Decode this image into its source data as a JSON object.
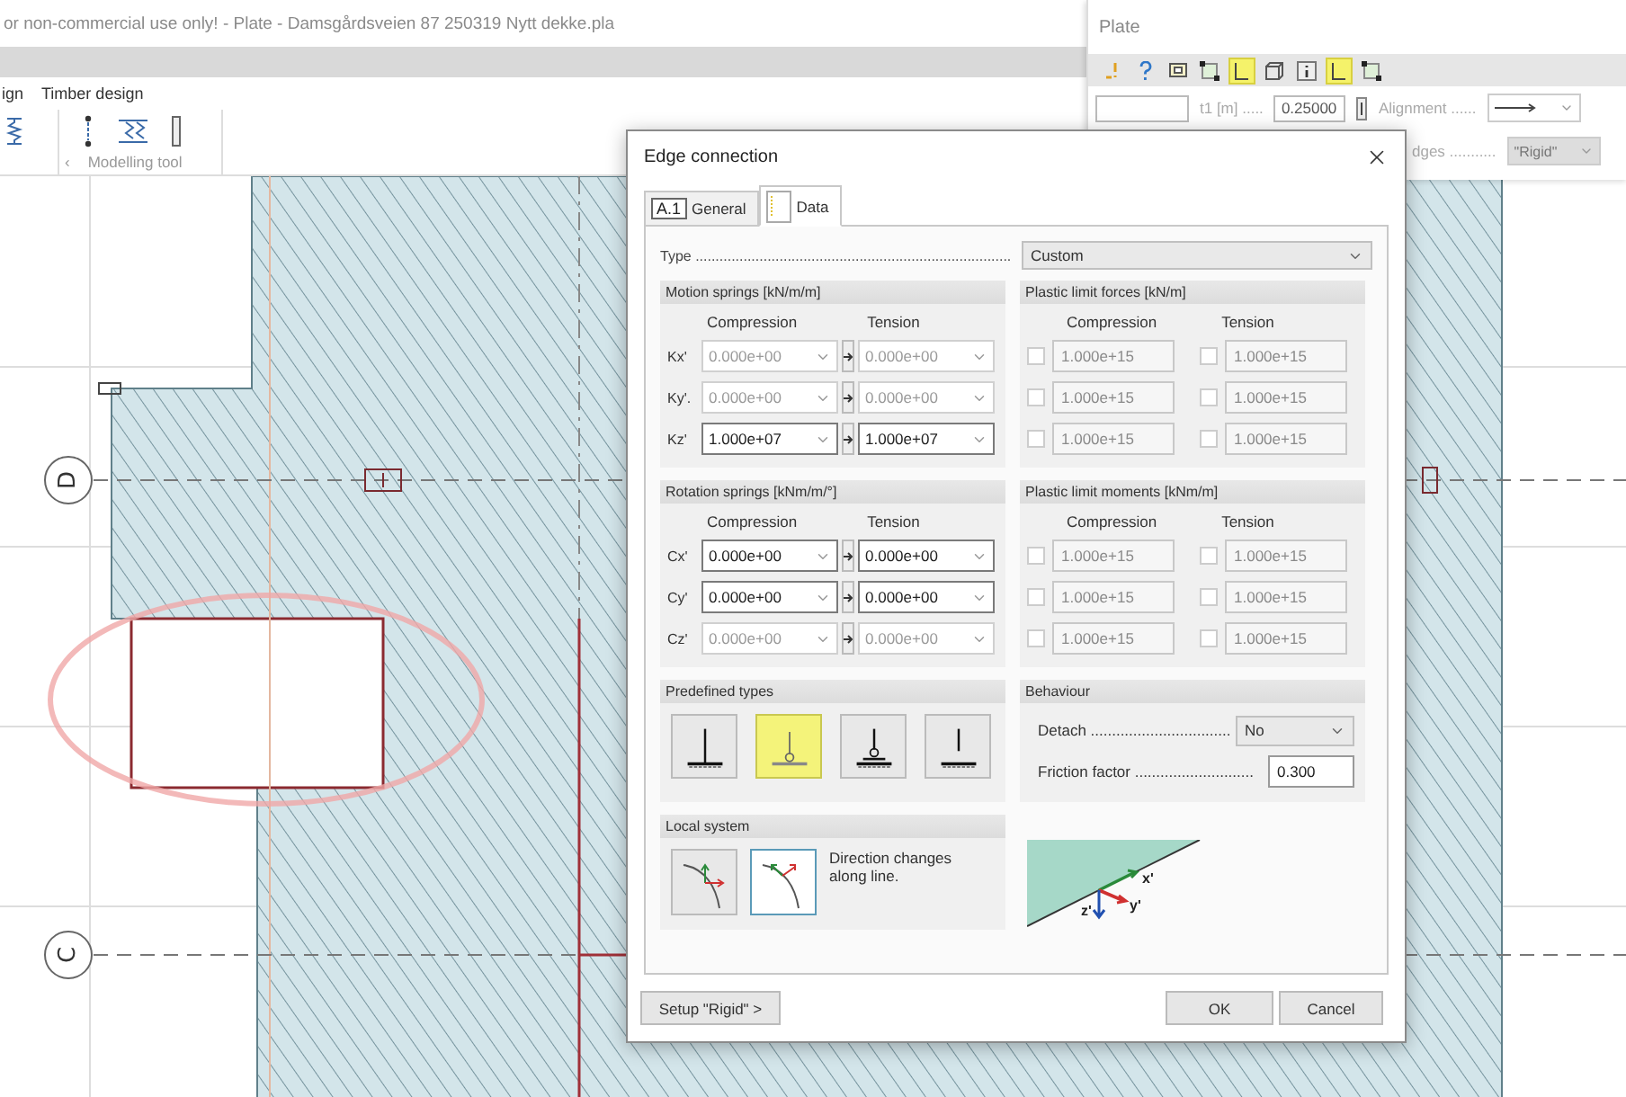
{
  "app": {
    "title": "or non-commercial use only! - Plate - Damsgårdsveien 87 250319 Nytt dekke.pla",
    "menu": [
      "ign",
      "Timber design"
    ],
    "toolbar_group": {
      "arrow": "‹",
      "label": "Modelling tool"
    }
  },
  "canvas": {
    "axes": [
      {
        "label": "D"
      },
      {
        "label": "C"
      }
    ]
  },
  "plate_panel": {
    "title": "Plate",
    "tools": [
      {
        "kind": "warning",
        "selected": false
      },
      {
        "kind": "help",
        "selected": false
      },
      {
        "kind": "frame",
        "selected": false
      },
      {
        "kind": "corners",
        "selected": false
      },
      {
        "kind": "edge",
        "selected": true
      },
      {
        "kind": "cube",
        "selected": false
      },
      {
        "kind": "info",
        "selected": false
      },
      {
        "kind": "edge",
        "selected": true
      },
      {
        "kind": "corners",
        "selected": false
      }
    ],
    "thickness": {
      "label": "t1 [m] .....",
      "value": "0.25000"
    },
    "alignment": {
      "label": "Alignment ......"
    },
    "edges": {
      "label": "dges ...........",
      "value": "\"Rigid\"",
      "disabled": true
    }
  },
  "dialog": {
    "title": "Edge connection",
    "tabs": [
      {
        "kind": "badge",
        "badge": "A.1",
        "label": "General",
        "selected": false
      },
      {
        "kind": "icon",
        "label": "Data",
        "selected": true
      }
    ],
    "type": {
      "label": "Type ...............................................................................",
      "value": "Custom"
    },
    "motion_springs": {
      "title": "Motion springs [kN/m/m]",
      "columns": [
        "Compression",
        "Tension"
      ],
      "rows": [
        {
          "label": "Kx'",
          "compression": "0.000e+00",
          "tension": "0.000e+00",
          "disabled": true
        },
        {
          "label": "Ky'.",
          "compression": "0.000e+00",
          "tension": "0.000e+00",
          "disabled": true
        },
        {
          "label": "Kz'",
          "compression": "1.000e+07",
          "tension": "1.000e+07",
          "disabled": false
        }
      ]
    },
    "plastic_limit_forces": {
      "title": "Plastic limit forces [kN/m]",
      "columns": [
        "Compression",
        "Tension"
      ],
      "rows": [
        {
          "compression": {
            "checked": false,
            "value": "1.000e+15"
          },
          "tension": {
            "checked": false,
            "value": "1.000e+15"
          }
        },
        {
          "compression": {
            "checked": false,
            "value": "1.000e+15"
          },
          "tension": {
            "checked": false,
            "value": "1.000e+15"
          }
        },
        {
          "compression": {
            "checked": false,
            "value": "1.000e+15"
          },
          "tension": {
            "checked": false,
            "value": "1.000e+15"
          }
        }
      ]
    },
    "rotation_springs": {
      "title": "Rotation springs [kNm/m/°]",
      "columns": [
        "Compression",
        "Tension"
      ],
      "rows": [
        {
          "label": "Cx'",
          "compression": "0.000e+00",
          "tension": "0.000e+00",
          "disabled": false
        },
        {
          "label": "Cy'",
          "compression": "0.000e+00",
          "tension": "0.000e+00",
          "disabled": false
        },
        {
          "label": "Cz'",
          "compression": "0.000e+00",
          "tension": "0.000e+00",
          "disabled": true
        }
      ]
    },
    "plastic_limit_moments": {
      "title": "Plastic limit moments [kNm/m]",
      "columns": [
        "Compression",
        "Tension"
      ],
      "rows": [
        {
          "compression": {
            "checked": false,
            "value": "1.000e+15"
          },
          "tension": {
            "checked": false,
            "value": "1.000e+15"
          }
        },
        {
          "compression": {
            "checked": false,
            "value": "1.000e+15"
          },
          "tension": {
            "checked": false,
            "value": "1.000e+15"
          }
        },
        {
          "compression": {
            "checked": false,
            "value": "1.000e+15"
          },
          "tension": {
            "checked": false,
            "value": "1.000e+15"
          }
        }
      ]
    },
    "predefined_types": {
      "title": "Predefined types",
      "items": [
        {
          "kind": "fixed",
          "selected": false
        },
        {
          "kind": "hinge",
          "selected": true
        },
        {
          "kind": "roller",
          "selected": false
        },
        {
          "kind": "free",
          "selected": false
        }
      ]
    },
    "behaviour": {
      "title": "Behaviour",
      "detach": {
        "label": "Detach .................................",
        "value": "No"
      },
      "friction": {
        "label": "Friction factor ............................",
        "value": "0.300"
      }
    },
    "local_system": {
      "title": "Local system",
      "options": [
        {
          "kind": "fixed",
          "selected": false
        },
        {
          "kind": "follow",
          "selected": true
        }
      ],
      "note": "Direction changes along line."
    },
    "axis_labels": [
      "x'",
      "y'",
      "z'"
    ],
    "buttons": {
      "setup": "Setup \"Rigid\" >",
      "ok": "OK",
      "cancel": "Cancel"
    }
  }
}
